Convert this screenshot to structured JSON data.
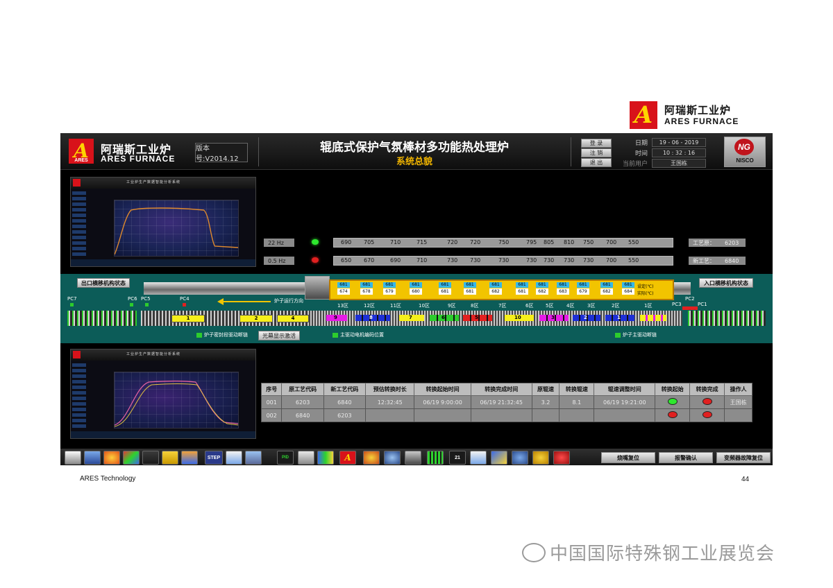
{
  "brand": {
    "cn": "阿瑞斯工业炉",
    "en": "ARES FURNACE",
    "logo_letter": "A",
    "logo_small": "ARES"
  },
  "header": {
    "version": "版本号:V2014.12",
    "title": "辊底式保护气氛棒材多功能热处理炉",
    "subtitle": "系统总貌",
    "buttons": {
      "login": "登 录",
      "logout": "注 销",
      "exit": "退 出"
    },
    "date_label": "日期",
    "date_value": "19 - 06 - 2019",
    "time_label": "时间",
    "time_value": "10 : 32 : 16",
    "user_label": "当前用户",
    "user_value": "王国栋",
    "nisco": "NISCO",
    "nisco_mark": "NG"
  },
  "thumbnail": {
    "title": "工业炉生产数据智能分析系统",
    "brand_en": "ARES Furnace"
  },
  "speed_rows": [
    {
      "freq": "22  Hz",
      "lamp": "#2ee82e",
      "values": [
        "690",
        "705",
        "710",
        "715",
        "720",
        "720",
        "750",
        "795",
        "805",
        "810",
        "750",
        "700",
        "550"
      ],
      "label": "工艺原：",
      "code": "6203"
    },
    {
      "freq": "0.5  Hz",
      "lamp": "#e02020",
      "values": [
        "650",
        "670",
        "690",
        "710",
        "730",
        "730",
        "730",
        "730",
        "730",
        "730",
        "730",
        "700",
        "550"
      ],
      "label": "新工艺：",
      "code": "6840"
    }
  ],
  "furnace": {
    "exit_label": "出口横移机构状态",
    "entry_label": "入口横移机构状态",
    "direction": "炉子运行方向",
    "set_label": "设定(℃)",
    "act_label": "实际(℃)",
    "tc_set": [
      "681",
      "681",
      "681",
      "681",
      "681",
      "681",
      "681",
      "681",
      "681",
      "681",
      "681",
      "681",
      "681"
    ],
    "tc_act": [
      "674",
      "678",
      "679",
      "680",
      "681",
      "681",
      "682",
      "681",
      "682",
      "683",
      "679",
      "682",
      "684"
    ],
    "pcs": [
      "PC7",
      "PC6",
      "PC5",
      "PC4",
      "PC3",
      "PC2",
      "PC1"
    ],
    "zones": [
      "13区",
      "12区",
      "11区",
      "10区",
      "9区",
      "8区",
      "7区",
      "6区",
      "5区",
      "4区",
      "3区",
      "2区",
      "1区"
    ],
    "bars": [
      "1",
      "2",
      "4"
    ],
    "colored_bars": [
      "9",
      "8",
      "7",
      "6",
      "5",
      "3",
      "2",
      "1",
      "10"
    ],
    "legend": [
      "炉子密封段驱动断链",
      "光幕显示激活",
      "主驱动电机编码位置",
      "炉子主驱动断链"
    ]
  },
  "table": {
    "headers": [
      "序号",
      "原工艺代码",
      "新工艺代码",
      "预估转换时长",
      "转换起始时间",
      "转换完成时间",
      "原辊速",
      "转换辊速",
      "辊速调整时间",
      "转换起始",
      "转换完成",
      "操作人"
    ],
    "rows": [
      [
        "001",
        "6203",
        "6840",
        "12:32:45",
        "06/19 9:00:00",
        "06/19 21:32:45",
        "3.2",
        "8.1",
        "06/19 19:21:00",
        "",
        "",
        "王国栋"
      ],
      [
        "002",
        "6840",
        "6203",
        "",
        "",
        "",
        "",
        "",
        "",
        "",
        "",
        ""
      ]
    ],
    "lamps": [
      [
        "#2ee82e",
        "#e02020"
      ],
      [
        "#e02020",
        "#e02020"
      ]
    ]
  },
  "taskbar": {
    "buttons": [
      "烧嘴复位",
      "报警确认",
      "变频器故障复位"
    ],
    "icons": [
      "home-icon",
      "monitor-icon",
      "flame-icon",
      "chart-icon",
      "envelope-icon",
      "warning-icon",
      "refresh-icon",
      "step-icon",
      "document-icon",
      "calendar-icon",
      "pid-icon",
      "printer-icon",
      "bars-icon",
      "ares-icon",
      "signal-icon",
      "search-icon",
      "list-icon",
      "grid-icon",
      "date-icon",
      "report-icon",
      "users-icon",
      "user-icon",
      "key-icon",
      "close-icon"
    ],
    "step_text": "STEP",
    "pid_text": "PID",
    "date_text": "21"
  },
  "footer": {
    "company": "ARES Technology",
    "page": "44"
  },
  "watermark": "中国国际特殊钢工业展览会"
}
